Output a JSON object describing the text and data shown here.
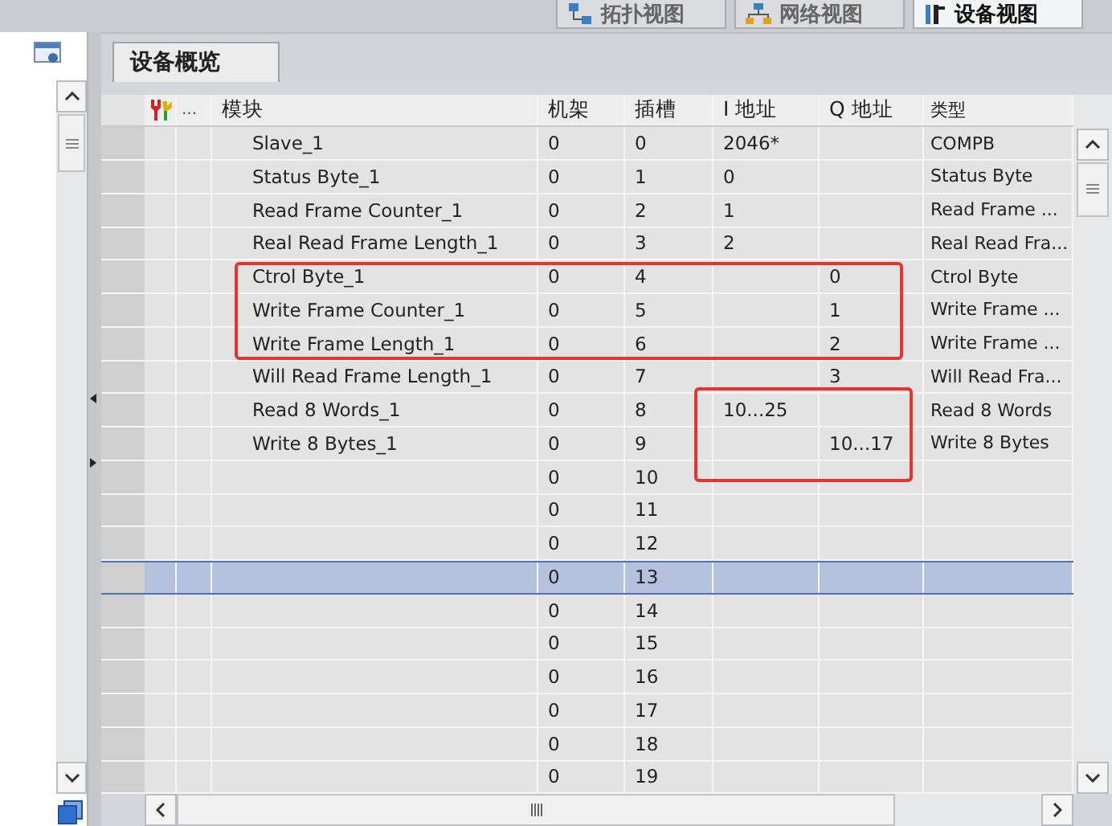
{
  "view_tabs": [
    {
      "label": "拓扑视图",
      "kind": "topology",
      "selected": false
    },
    {
      "label": "网络视图",
      "kind": "network",
      "selected": false
    },
    {
      "label": "设备视图",
      "kind": "device",
      "selected": true
    }
  ],
  "panel_tab": {
    "label": "设备概览"
  },
  "table": {
    "columns": [
      "...",
      "模块",
      "机架",
      "插槽",
      "I 地址",
      "Q 地址",
      "类型"
    ],
    "rows": [
      {
        "module": "Slave_1",
        "rack": "0",
        "slot": "0",
        "i_address": "2046*",
        "q_address": "",
        "type": "COMPB",
        "selected": false
      },
      {
        "module": "Status Byte_1",
        "rack": "0",
        "slot": "1",
        "i_address": "0",
        "q_address": "",
        "type": "Status Byte",
        "selected": false
      },
      {
        "module": "Read Frame Counter_1",
        "rack": "0",
        "slot": "2",
        "i_address": "1",
        "q_address": "",
        "type": "Read Frame ...",
        "selected": false
      },
      {
        "module": "Real Read Frame Length_1",
        "rack": "0",
        "slot": "3",
        "i_address": "2",
        "q_address": "",
        "type": "Real Read Fra...",
        "selected": false
      },
      {
        "module": "Ctrol Byte_1",
        "rack": "0",
        "slot": "4",
        "i_address": "",
        "q_address": "0",
        "type": "Ctrol Byte",
        "selected": false
      },
      {
        "module": "Write Frame Counter_1",
        "rack": "0",
        "slot": "5",
        "i_address": "",
        "q_address": "1",
        "type": "Write Frame ...",
        "selected": false
      },
      {
        "module": "Write Frame Length_1",
        "rack": "0",
        "slot": "6",
        "i_address": "",
        "q_address": "2",
        "type": "Write Frame ...",
        "selected": false
      },
      {
        "module": "Will Read Frame Length_1",
        "rack": "0",
        "slot": "7",
        "i_address": "",
        "q_address": "3",
        "type": "Will Read Fra...",
        "selected": false
      },
      {
        "module": "Read 8 Words_1",
        "rack": "0",
        "slot": "8",
        "i_address": "10...25",
        "q_address": "",
        "type": "Read 8 Words",
        "selected": false
      },
      {
        "module": "Write 8 Bytes_1",
        "rack": "0",
        "slot": "9",
        "i_address": "",
        "q_address": "10...17",
        "type": "Write 8 Bytes",
        "selected": false
      },
      {
        "module": "",
        "rack": "0",
        "slot": "10",
        "i_address": "",
        "q_address": "",
        "type": "",
        "selected": false
      },
      {
        "module": "",
        "rack": "0",
        "slot": "11",
        "i_address": "",
        "q_address": "",
        "type": "",
        "selected": false
      },
      {
        "module": "",
        "rack": "0",
        "slot": "12",
        "i_address": "",
        "q_address": "",
        "type": "",
        "selected": false
      },
      {
        "module": "",
        "rack": "0",
        "slot": "13",
        "i_address": "",
        "q_address": "",
        "type": "",
        "selected": true
      },
      {
        "module": "",
        "rack": "0",
        "slot": "14",
        "i_address": "",
        "q_address": "",
        "type": "",
        "selected": false
      },
      {
        "module": "",
        "rack": "0",
        "slot": "15",
        "i_address": "",
        "q_address": "",
        "type": "",
        "selected": false
      },
      {
        "module": "",
        "rack": "0",
        "slot": "16",
        "i_address": "",
        "q_address": "",
        "type": "",
        "selected": false
      },
      {
        "module": "",
        "rack": "0",
        "slot": "17",
        "i_address": "",
        "q_address": "",
        "type": "",
        "selected": false
      },
      {
        "module": "",
        "rack": "0",
        "slot": "18",
        "i_address": "",
        "q_address": "",
        "type": "",
        "selected": false
      },
      {
        "module": "",
        "rack": "0",
        "slot": "19",
        "i_address": "",
        "q_address": "",
        "type": "",
        "selected": false
      }
    ]
  },
  "annotations": [
    {
      "kind": "rectangle",
      "color": "#e8332f"
    },
    {
      "kind": "rectangle",
      "color": "#e8332f"
    }
  ]
}
